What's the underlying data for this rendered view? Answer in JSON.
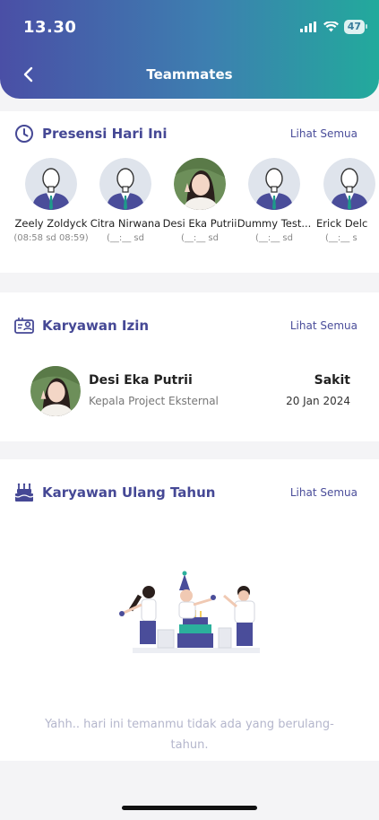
{
  "status_bar": {
    "time": "13.30",
    "battery": "47"
  },
  "header": {
    "title": "Teammates"
  },
  "attendance": {
    "title": "Presensi Hari Ini",
    "see_all": "Lihat Semua",
    "items": [
      {
        "name": "Zeely Zoldyck",
        "time": "(08:58 sd 08:59)"
      },
      {
        "name": "Citra Nirwana",
        "time": "(__:__ sd"
      },
      {
        "name": "Desi Eka Putrii",
        "time": "(__:__ sd"
      },
      {
        "name": "Dummy Test...",
        "time": "(__:__ sd"
      },
      {
        "name": "Erick Delc",
        "time": "(__:__ s"
      }
    ]
  },
  "leave": {
    "title": "Karyawan Izin",
    "see_all": "Lihat Semua",
    "employee": {
      "name": "Desi Eka Putrii",
      "role": "Kepala Project Eksternal",
      "type": "Sakit",
      "date": "20 Jan 2024"
    }
  },
  "birthday": {
    "title": "Karyawan Ulang Tahun",
    "see_all": "Lihat Semua",
    "empty_message": "Yahh.. hari ini temanmu tidak ada yang berulang-tahun."
  },
  "colors": {
    "primary": "#454895",
    "gradient_start": "#4a4fa6",
    "gradient_end": "#22aa9c"
  }
}
